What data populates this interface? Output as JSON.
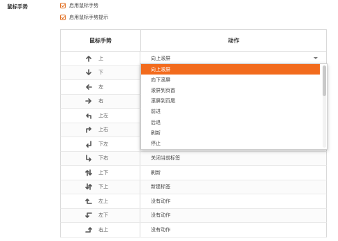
{
  "section_label": "鼠标手势",
  "options": [
    {
      "label": "启用鼠标手势",
      "checked": true
    },
    {
      "label": "启用鼠标手势提示",
      "checked": true
    }
  ],
  "table": {
    "col_gesture": "鼠标手势",
    "col_action": "动作",
    "rows": [
      {
        "icon": "arrow-up-icon",
        "gesture": "上",
        "action": "向上滚屏"
      },
      {
        "icon": "arrow-down-icon",
        "gesture": "下",
        "action": ""
      },
      {
        "icon": "arrow-left-icon",
        "gesture": "左",
        "action": ""
      },
      {
        "icon": "arrow-right-icon",
        "gesture": "右",
        "action": ""
      },
      {
        "icon": "arrow-up-left-icon",
        "gesture": "上左",
        "action": ""
      },
      {
        "icon": "arrow-up-right-icon",
        "gesture": "上右",
        "action": ""
      },
      {
        "icon": "arrow-down-left-icon",
        "gesture": "下左",
        "action": ""
      },
      {
        "icon": "arrow-down-right-icon",
        "gesture": "下右",
        "action": "关闭当前标签"
      },
      {
        "icon": "arrow-up-down-icon",
        "gesture": "上下",
        "action": "刷新"
      },
      {
        "icon": "arrow-down-up-icon",
        "gesture": "下上",
        "action": "新建标签"
      },
      {
        "icon": "arrow-left-up-icon",
        "gesture": "左上",
        "action": "没有动作"
      },
      {
        "icon": "arrow-left-down-icon",
        "gesture": "左下",
        "action": "没有动作"
      },
      {
        "icon": "arrow-right-up-icon",
        "gesture": "右上",
        "action": "没有动作"
      }
    ]
  },
  "dropdown": {
    "selected": "向上滚屏",
    "options": [
      "向上滚屏",
      "向下滚屏",
      "滚屏到页首",
      "滚屏到页尾",
      "前进",
      "后退",
      "刷新",
      "停止"
    ]
  },
  "colors": {
    "accent": "#f26b1d",
    "border": "#d9d9d9"
  }
}
